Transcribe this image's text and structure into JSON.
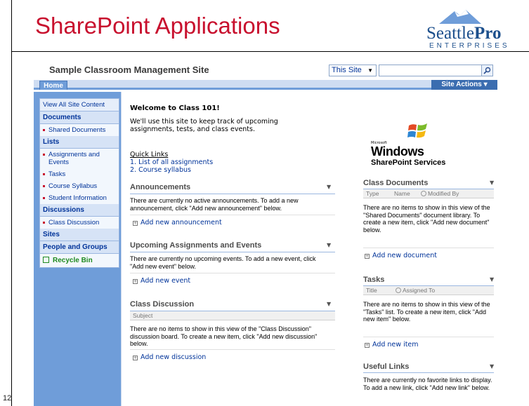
{
  "slide": {
    "title": "SharePoint Applications",
    "logo_word_1": "Seattle",
    "logo_word_2": "Pro",
    "logo_sub": "ENTERPRISES",
    "page_number": "12"
  },
  "site": {
    "title": "Sample Classroom Management Site",
    "search_scope": "This Site",
    "search_value": "",
    "tab_home": "Home",
    "site_actions": "Site Actions ▾"
  },
  "quicklaunch": {
    "view_all": "View All Site Content",
    "documents": "Documents",
    "shared_documents": "Shared Documents",
    "lists": "Lists",
    "assignments_events": "Assignments and Events",
    "tasks": "Tasks",
    "course_syllabus": "Course Syllabus",
    "student_info": "Student Information",
    "discussions": "Discussions",
    "class_discussion": "Class Discussion",
    "sites": "Sites",
    "people_groups": "People and Groups",
    "recycle_bin": "Recycle Bin"
  },
  "welcome": {
    "title": "Welcome to Class 101!",
    "text": "We'll use this site to keep track of upcoming assignments, tests, and class events.",
    "quick_links": "Quick Links",
    "link_1": "1. List of all assignments",
    "link_2": "2. Course syllabus"
  },
  "announcements": {
    "title": "Announcements",
    "text": "There are currently no active announcements. To add a new announcement, click \"Add new announcement\" below.",
    "add": "Add new announcement"
  },
  "events": {
    "title": "Upcoming Assignments and Events",
    "text": "There are currently no upcoming events. To add a new event, click \"Add new event\" below.",
    "add": "Add new event"
  },
  "discussion": {
    "title": "Class Discussion",
    "col_subject": "Subject",
    "text": "There are no items to show in this view of the \"Class Discussion\" discussion board. To create a new item, click \"Add new discussion\" below.",
    "add": "Add new discussion"
  },
  "wss_logo": {
    "ms": "Microsoft",
    "windows": "Windows",
    "sps": "SharePoint Services"
  },
  "class_documents": {
    "title": "Class Documents",
    "col_type": "Type",
    "col_name": "Name",
    "col_modified": "Modified By",
    "text": "There are no items to show in this view of the \"Shared Documents\" document library. To create a new item, click \"Add new document\" below.",
    "add": "Add new document"
  },
  "tasks": {
    "title": "Tasks",
    "col_title": "Title",
    "col_assigned": "Assigned To",
    "text": "There are no items to show in this view of the \"Tasks\" list. To create a new item, click \"Add new item\" below.",
    "add": "Add new item"
  },
  "useful_links": {
    "title": "Useful Links",
    "text": "There are currently no favorite links to display. To add a new link, click \"Add new link\" below."
  },
  "colors": {
    "title_red": "#c8102e",
    "sp_blue": "#6f9dd9",
    "link_blue": "#003399"
  }
}
